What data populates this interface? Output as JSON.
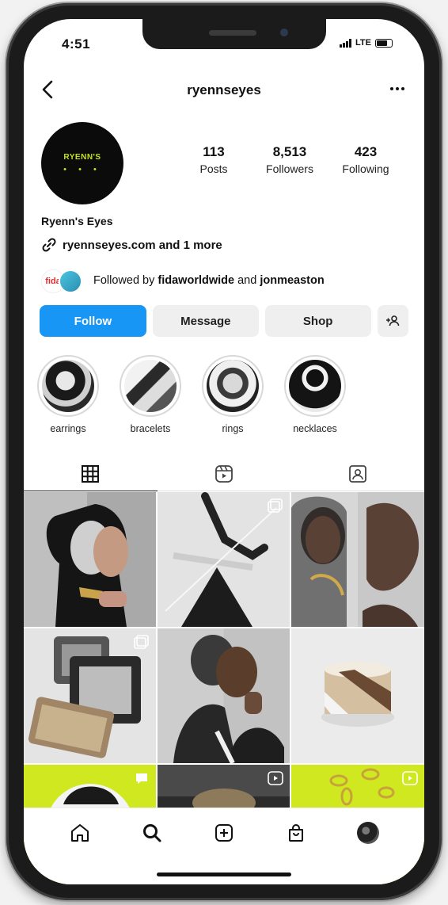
{
  "status_bar": {
    "time": "4:51",
    "network": "LTE"
  },
  "header": {
    "username": "ryennseyes"
  },
  "profile": {
    "avatar_text": "RYENN'S",
    "avatar_dots": "• • •",
    "stats": [
      {
        "value": "113",
        "label": "Posts"
      },
      {
        "value": "8,513",
        "label": "Followers"
      },
      {
        "value": "423",
        "label": "Following"
      }
    ],
    "display_name": "Ryenn's Eyes",
    "link_text": "ryennseyes.com and 1 more",
    "followed_by_prefix": "Followed by",
    "followed_by_user1": "fidaworldwide",
    "followed_by_and": "and",
    "followed_by_user2": "jonmeaston",
    "mutual_badge": "fida"
  },
  "actions": {
    "follow": "Follow",
    "message": "Message",
    "shop": "Shop"
  },
  "highlights": [
    {
      "label": "earrings"
    },
    {
      "label": "bracelets"
    },
    {
      "label": "rings"
    },
    {
      "label": "necklaces"
    }
  ],
  "tabs": [
    {
      "icon": "grid-icon"
    },
    {
      "icon": "reels-icon"
    },
    {
      "icon": "tagged-icon"
    }
  ],
  "colors": {
    "follow_blue": "#1896f5",
    "brand_lime": "#c6e31a"
  }
}
